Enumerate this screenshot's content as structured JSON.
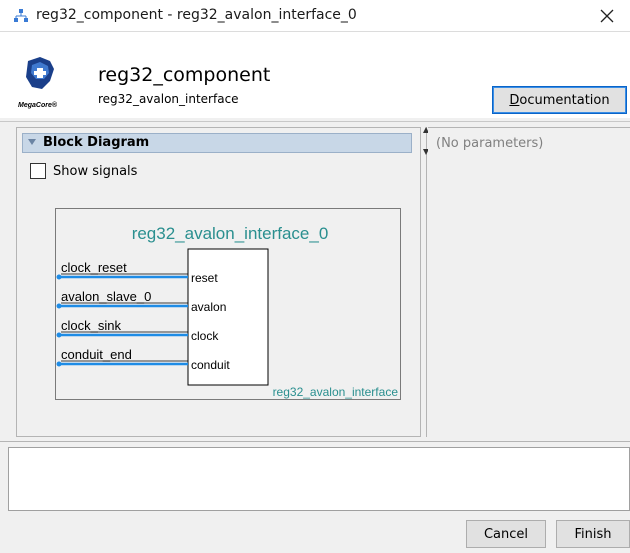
{
  "window": {
    "title": "reg32_component - reg32_avalon_interface_0",
    "close_glyph": "✕",
    "icon": "component-hierarchy-icon"
  },
  "header": {
    "component_name": "reg32_component",
    "component_subtitle": "reg32_avalon_interface",
    "logo_text": "MegaCore®",
    "documentation_button": {
      "mnemonic": "D",
      "rest": "ocumentation"
    }
  },
  "block_diagram": {
    "section_title": "Block Diagram",
    "show_signals_label": "Show signals",
    "show_signals_checked": false,
    "instance_name": "reg32_avalon_interface_0",
    "module_name": "reg32_avalon_interface",
    "interfaces": [
      {
        "name": "clock_reset",
        "port": "reset"
      },
      {
        "name": "avalon_slave_0",
        "port": "avalon"
      },
      {
        "name": "clock_sink",
        "port": "clock"
      },
      {
        "name": "conduit_end",
        "port": "conduit"
      }
    ]
  },
  "parameters": {
    "empty_text": "(No parameters)"
  },
  "footer": {
    "cancel_label": "Cancel",
    "finish_label": "Finish"
  },
  "colors": {
    "accent": "#0a64c8",
    "wire": "#1e8ce6",
    "instance_text": "#2a8f8f",
    "header_bar": "#c8d7e7"
  }
}
